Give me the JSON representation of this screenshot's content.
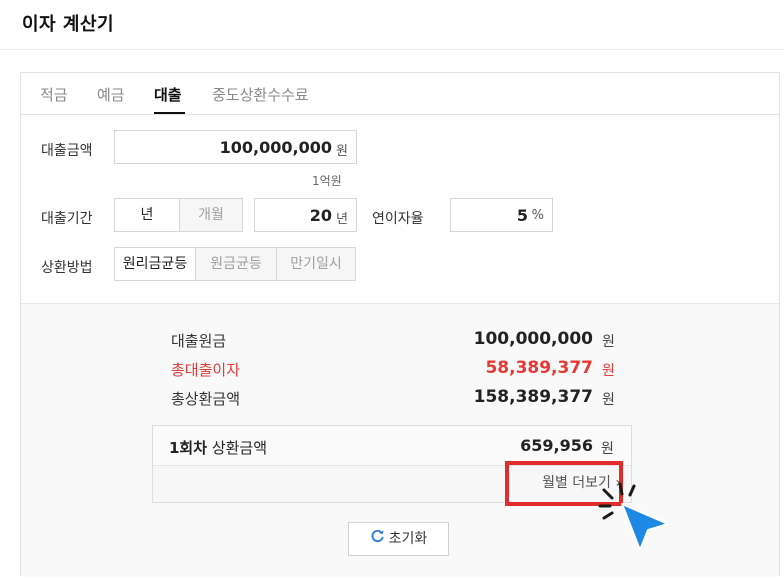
{
  "header": {
    "title": "이자 계산기"
  },
  "tabs": [
    {
      "label": "적금",
      "active": false
    },
    {
      "label": "예금",
      "active": false
    },
    {
      "label": "대출",
      "active": true
    },
    {
      "label": "중도상환수수료",
      "active": false
    }
  ],
  "form": {
    "amount": {
      "label": "대출금액",
      "value": "100,000,000",
      "unit": "원",
      "hint": "1억원"
    },
    "period": {
      "label": "대출기간",
      "unit_options": [
        "년",
        "개월"
      ],
      "selected_unit": "년",
      "value": "20",
      "unit": "년"
    },
    "rate": {
      "label": "연이자율",
      "value": "5",
      "unit": "%"
    },
    "method": {
      "label": "상환방법",
      "options": [
        "원리금균등",
        "원금균등",
        "만기일시"
      ],
      "selected": "원리금균등"
    }
  },
  "results": {
    "principal": {
      "label": "대출원금",
      "value": "100,000,000",
      "unit": "원"
    },
    "interest": {
      "label": "총대출이자",
      "value": "58,389,377",
      "unit": "원"
    },
    "total": {
      "label": "총상환금액",
      "value": "158,389,377",
      "unit": "원"
    },
    "first_payment": {
      "label_bold": "1회차",
      "label_rest": " 상환금액",
      "value": "659,956",
      "unit": "원"
    },
    "more_link": "월별 더보기",
    "reset_label": "초기화"
  },
  "colors": {
    "accent_red": "#e53935",
    "highlight_red": "#e32b2b",
    "cursor_blue": "#1e88e5"
  }
}
